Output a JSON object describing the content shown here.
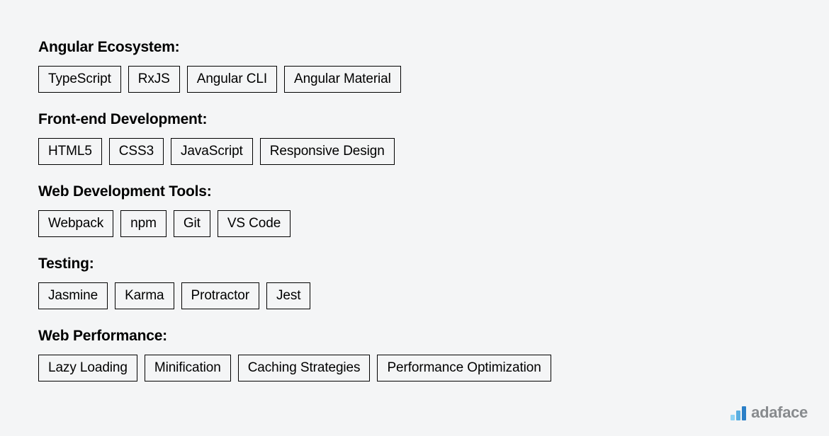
{
  "sections": [
    {
      "title": "Angular Ecosystem:",
      "tags": [
        "TypeScript",
        "RxJS",
        "Angular CLI",
        "Angular Material"
      ]
    },
    {
      "title": "Front-end Development:",
      "tags": [
        "HTML5",
        "CSS3",
        "JavaScript",
        "Responsive Design"
      ]
    },
    {
      "title": "Web Development Tools:",
      "tags": [
        "Webpack",
        "npm",
        "Git",
        "VS Code"
      ]
    },
    {
      "title": "Testing:",
      "tags": [
        "Jasmine",
        "Karma",
        "Protractor",
        "Jest"
      ]
    },
    {
      "title": "Web Performance:",
      "tags": [
        "Lazy Loading",
        "Minification",
        "Caching Strategies",
        "Performance Optimization"
      ]
    }
  ],
  "logo": {
    "text": "adaface"
  }
}
